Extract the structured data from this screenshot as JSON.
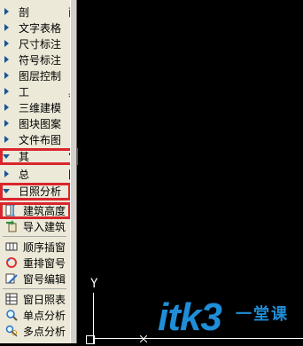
{
  "menu": {
    "categories_top": [
      {
        "label": "剖　面",
        "spaced": true
      },
      {
        "label": "文字表格"
      },
      {
        "label": "尺寸标注"
      },
      {
        "label": "符号标注"
      },
      {
        "label": "图层控制"
      },
      {
        "label": "工　具",
        "spaced": true
      },
      {
        "label": "三维建模"
      },
      {
        "label": "图块图案"
      },
      {
        "label": "文件布图"
      }
    ],
    "expanded_other": {
      "label": "其　它"
    },
    "sub_items": [
      {
        "label": "总　图"
      }
    ],
    "expanded_sunlight": {
      "label": "日照分析"
    },
    "tools": [
      {
        "label": "建筑高度",
        "icon": "building-height-icon"
      },
      {
        "label": "导入建筑",
        "icon": "import-building-icon"
      },
      {
        "label": "顺序插窗",
        "icon": "insert-window-icon"
      },
      {
        "label": "重排窗号",
        "icon": "renumber-window-icon"
      },
      {
        "label": "窗号编辑",
        "icon": "edit-window-number-icon"
      },
      {
        "label": "窗日照表",
        "icon": "window-sunlight-table-icon"
      },
      {
        "label": "单点分析",
        "icon": "single-point-analysis-icon"
      },
      {
        "label": "多点分析",
        "icon": "multi-point-analysis-icon"
      }
    ]
  },
  "canvas": {
    "y_axis_label": "Y",
    "watermark": "itk3",
    "watermark_sub": "一堂课"
  },
  "colors": {
    "panel_bg": "#ece9d8",
    "highlight": "#d9262c",
    "triangle": "#16579a",
    "watermark": "#1f8ed8"
  }
}
